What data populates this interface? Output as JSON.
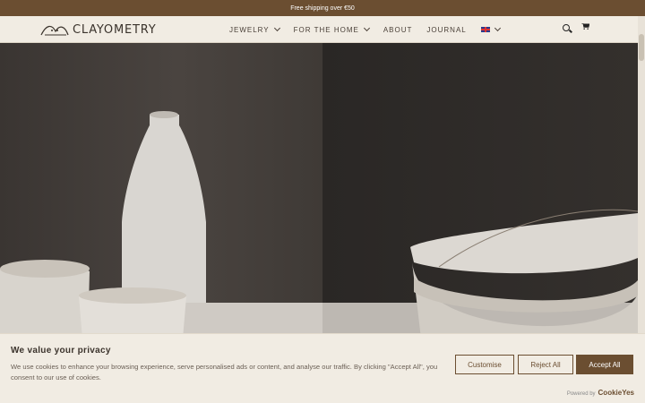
{
  "announcement": "Free shipping over €50",
  "brand": {
    "name": "CLAYOMETRY"
  },
  "nav": {
    "items": [
      {
        "label": "JEWELRY",
        "dropdown": true
      },
      {
        "label": "FOR THE HOME",
        "dropdown": true
      },
      {
        "label": "ABOUT",
        "dropdown": false
      },
      {
        "label": "JOURNAL",
        "dropdown": false
      }
    ],
    "language_icon": "uk-flag-icon"
  },
  "header_icons": [
    "search-icon",
    "cart-icon"
  ],
  "cookie": {
    "title": "We value your privacy",
    "text": "We use cookies to enhance your browsing experience, serve personalised ads or content, and analyse our traffic. By clicking \"Accept All\", you consent to our use of cookies.",
    "buttons": {
      "customise": "Customise",
      "reject": "Reject All",
      "accept": "Accept All"
    },
    "powered_by": "Powered by",
    "powered_brand": "CookieYes"
  },
  "colors": {
    "brand_brown": "#6b4e31",
    "background": "#f1ece3"
  }
}
